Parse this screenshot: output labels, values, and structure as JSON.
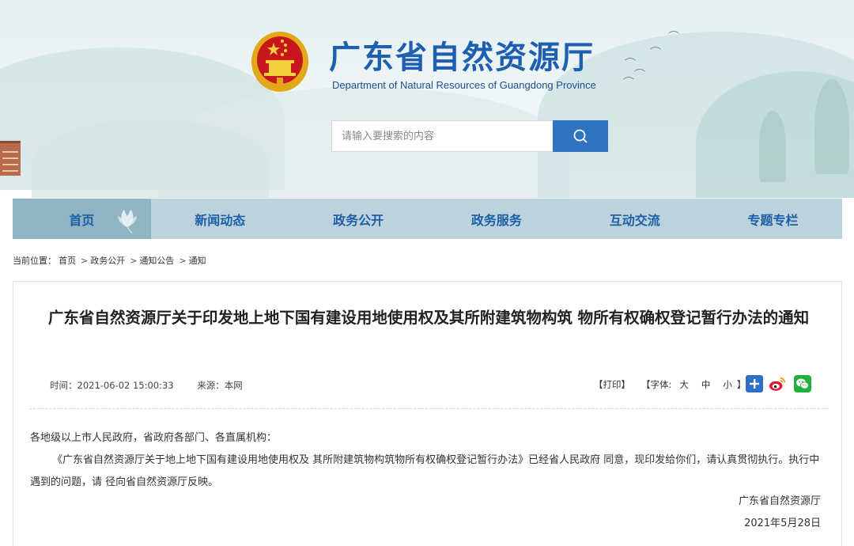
{
  "header": {
    "title": "广东省自然资源厅",
    "subtitle": "Department of Natural Resources of Guangdong Province",
    "emblem_icon": "national-emblem-icon"
  },
  "search": {
    "placeholder": "请输入要搜索的内容",
    "value": "",
    "button_icon": "search-icon"
  },
  "nav": {
    "items": [
      {
        "label": "首页"
      },
      {
        "label": "新闻动态"
      },
      {
        "label": "政务公开"
      },
      {
        "label": "政务服务"
      },
      {
        "label": "互动交流"
      },
      {
        "label": "专题专栏"
      }
    ]
  },
  "breadcrumb": {
    "prefix": "当前位置：",
    "items": [
      "首页",
      "政务公开",
      "通知公告",
      "通知"
    ],
    "separator": ">"
  },
  "article": {
    "title": "广东省自然资源厅关于印发地上地下国有建设用地使用权及其所附建筑物构筑 物所有权确权登记暂行办法的通知",
    "time": "时间：2021-06-02 15:00:33",
    "source": "来源：本网",
    "print_label": "【打印】",
    "font_label": "【字体:",
    "font_large": "大",
    "font_medium": "中",
    "font_small": "小",
    "font_close": "】",
    "salutation": "各地级以上市人民政府，省政府各部门、各直属机构：",
    "paragraph": "《广东省自然资源厅关于地上地下国有建设用地使用权及 其所附建筑物构筑物所有权确权登记暂行办法》已经省人民政府 同意，现印发给你们，请认真贯彻执行。执行中遇到的问题，请 径向省自然资源厅反映。",
    "signature": "广东省自然资源厅",
    "date": "2021年5月28日"
  },
  "colors": {
    "brand_blue": "#1f5fb0",
    "nav_bg": "#bcd3de",
    "nav_active": "#8fb4c2",
    "search_button": "#2f74c0"
  }
}
